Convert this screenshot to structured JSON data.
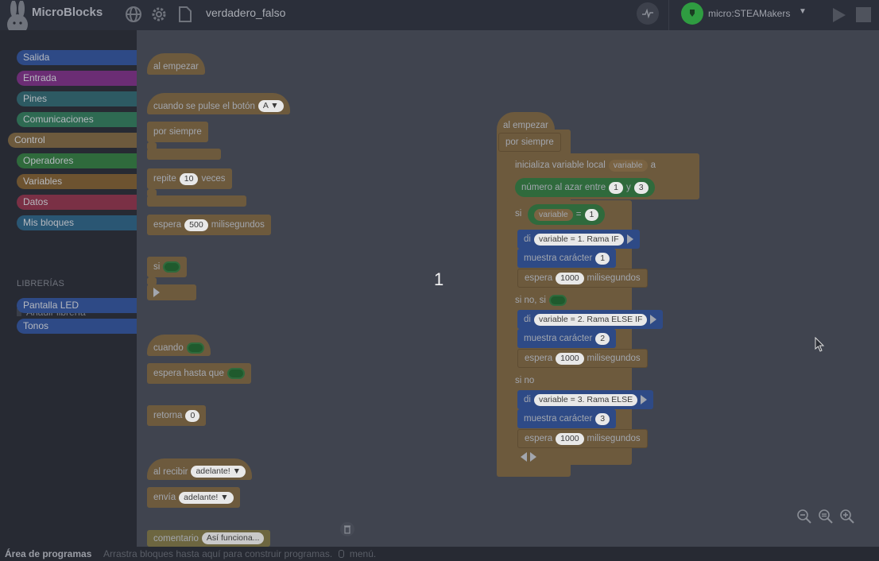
{
  "app": {
    "title": "MicroBlocks",
    "project_name": "verdadero_falso"
  },
  "device": {
    "name": "micro:STEAMakers"
  },
  "categories": [
    {
      "label": "Salida",
      "color": "#2e4a86"
    },
    {
      "label": "Entrada",
      "color": "#6b2d74"
    },
    {
      "label": "Pines",
      "color": "#2d5a63"
    },
    {
      "label": "Comunicaciones",
      "color": "#2e6a52"
    },
    {
      "label": "Control",
      "color": "#6d5a3d"
    },
    {
      "label": "Operadores",
      "color": "#2f6a3c"
    },
    {
      "label": "Variables",
      "color": "#6d5330"
    },
    {
      "label": "Datos",
      "color": "#7a3045"
    },
    {
      "label": "Mis bloques",
      "color": "#2a5673"
    }
  ],
  "libraries": {
    "header": "LIBRERÍAS",
    "add_label": "Añadir librería",
    "items": [
      {
        "label": "Pantalla LED",
        "color": "#2e4a86"
      },
      {
        "label": "Tonos",
        "color": "#2e4a86"
      }
    ]
  },
  "palette": {
    "when_started": "al empezar",
    "when_button": "cuando se pulse el botón",
    "button_value": "A ▼",
    "forever": "por siempre",
    "repeat": "repite",
    "repeat_count": "10",
    "repeat_times": "veces",
    "wait": "espera",
    "wait_value": "500",
    "wait_unit": "milisegundos",
    "if": "si",
    "when": "cuando",
    "wait_until": "espera hasta que",
    "return": "retorna",
    "return_value": "0",
    "when_receive": "al recibir",
    "receive_value": "adelante! ▼",
    "send": "envía",
    "send_value": "adelante! ▼",
    "comment": "comentario",
    "comment_value": "Así funciona..."
  },
  "script": {
    "when_started": "al empezar",
    "forever": "por siempre",
    "init_local": "inicializa variable local",
    "init_var": "variable",
    "init_to": "a",
    "random": "número al azar entre",
    "random_from": "1",
    "random_and": "y",
    "random_to": "3",
    "if": "si",
    "cond_var": "variable",
    "cond_op": "=",
    "cond_value": "1",
    "say": "di",
    "say1": "variable = 1. Rama IF",
    "show_char": "muestra carácter",
    "char1": "1",
    "wait": "espera",
    "wait_value": "1000",
    "wait_unit": "milisegundos",
    "else_if": "si no, si",
    "say2": "variable = 2. Rama ELSE IF",
    "char2": "2",
    "else": "si no",
    "say3": "variable = 3. Rama ELSE",
    "char3": "3"
  },
  "stage_value": "1",
  "status": {
    "title": "Área de programas",
    "hint": "Arrastra bloques hasta aquí para construir programas.",
    "menu": "menú."
  }
}
